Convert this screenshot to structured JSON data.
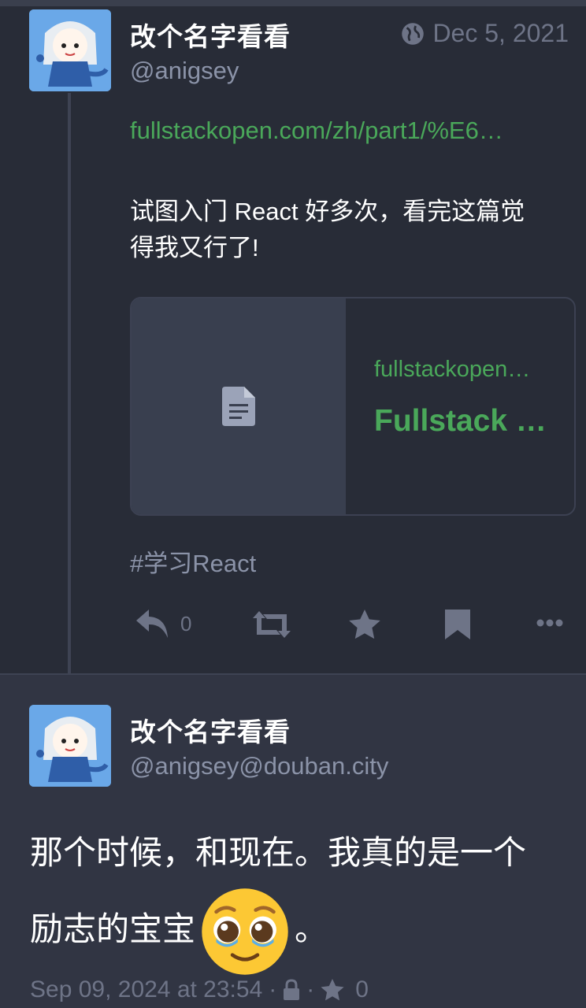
{
  "post1": {
    "display_name": "改个名字看看",
    "handle": "@anigsey",
    "date": "Dec 5, 2021",
    "link": "fullstackopen.com/zh/part1/%E6…",
    "body_line1": "试图入门 React 好多次，看完这篇觉",
    "body_line2": "得我又行了!",
    "card": {
      "domain": "fullstackopen…",
      "title": "Fullstack …",
      "thumb_icon": "document-icon"
    },
    "hashtag": "#学习React",
    "actions": {
      "reply_count": "0",
      "icons": [
        "reply-icon",
        "boost-icon",
        "star-icon",
        "bookmark-icon",
        "more-icon"
      ]
    }
  },
  "post2": {
    "display_name": "改个名字看看",
    "handle": "@anigsey@douban.city",
    "body_line1": "那个时候，和现在。我真的是一个",
    "body_line2_before": "励志的宝宝",
    "body_line2_after": "。",
    "emoji": "pleading-face-emoji",
    "meta": {
      "timestamp": "Sep 09, 2024 at 23:54",
      "separator": "·",
      "visibility_icon": "lock-icon",
      "favourite_icon": "star-icon",
      "favourite_count": "0"
    }
  },
  "colors": {
    "background": "#282c37",
    "focused_background": "#313543",
    "link_green": "#4aa85a",
    "muted": "#6e7487",
    "avatar_blue": "#6aa8e8"
  }
}
